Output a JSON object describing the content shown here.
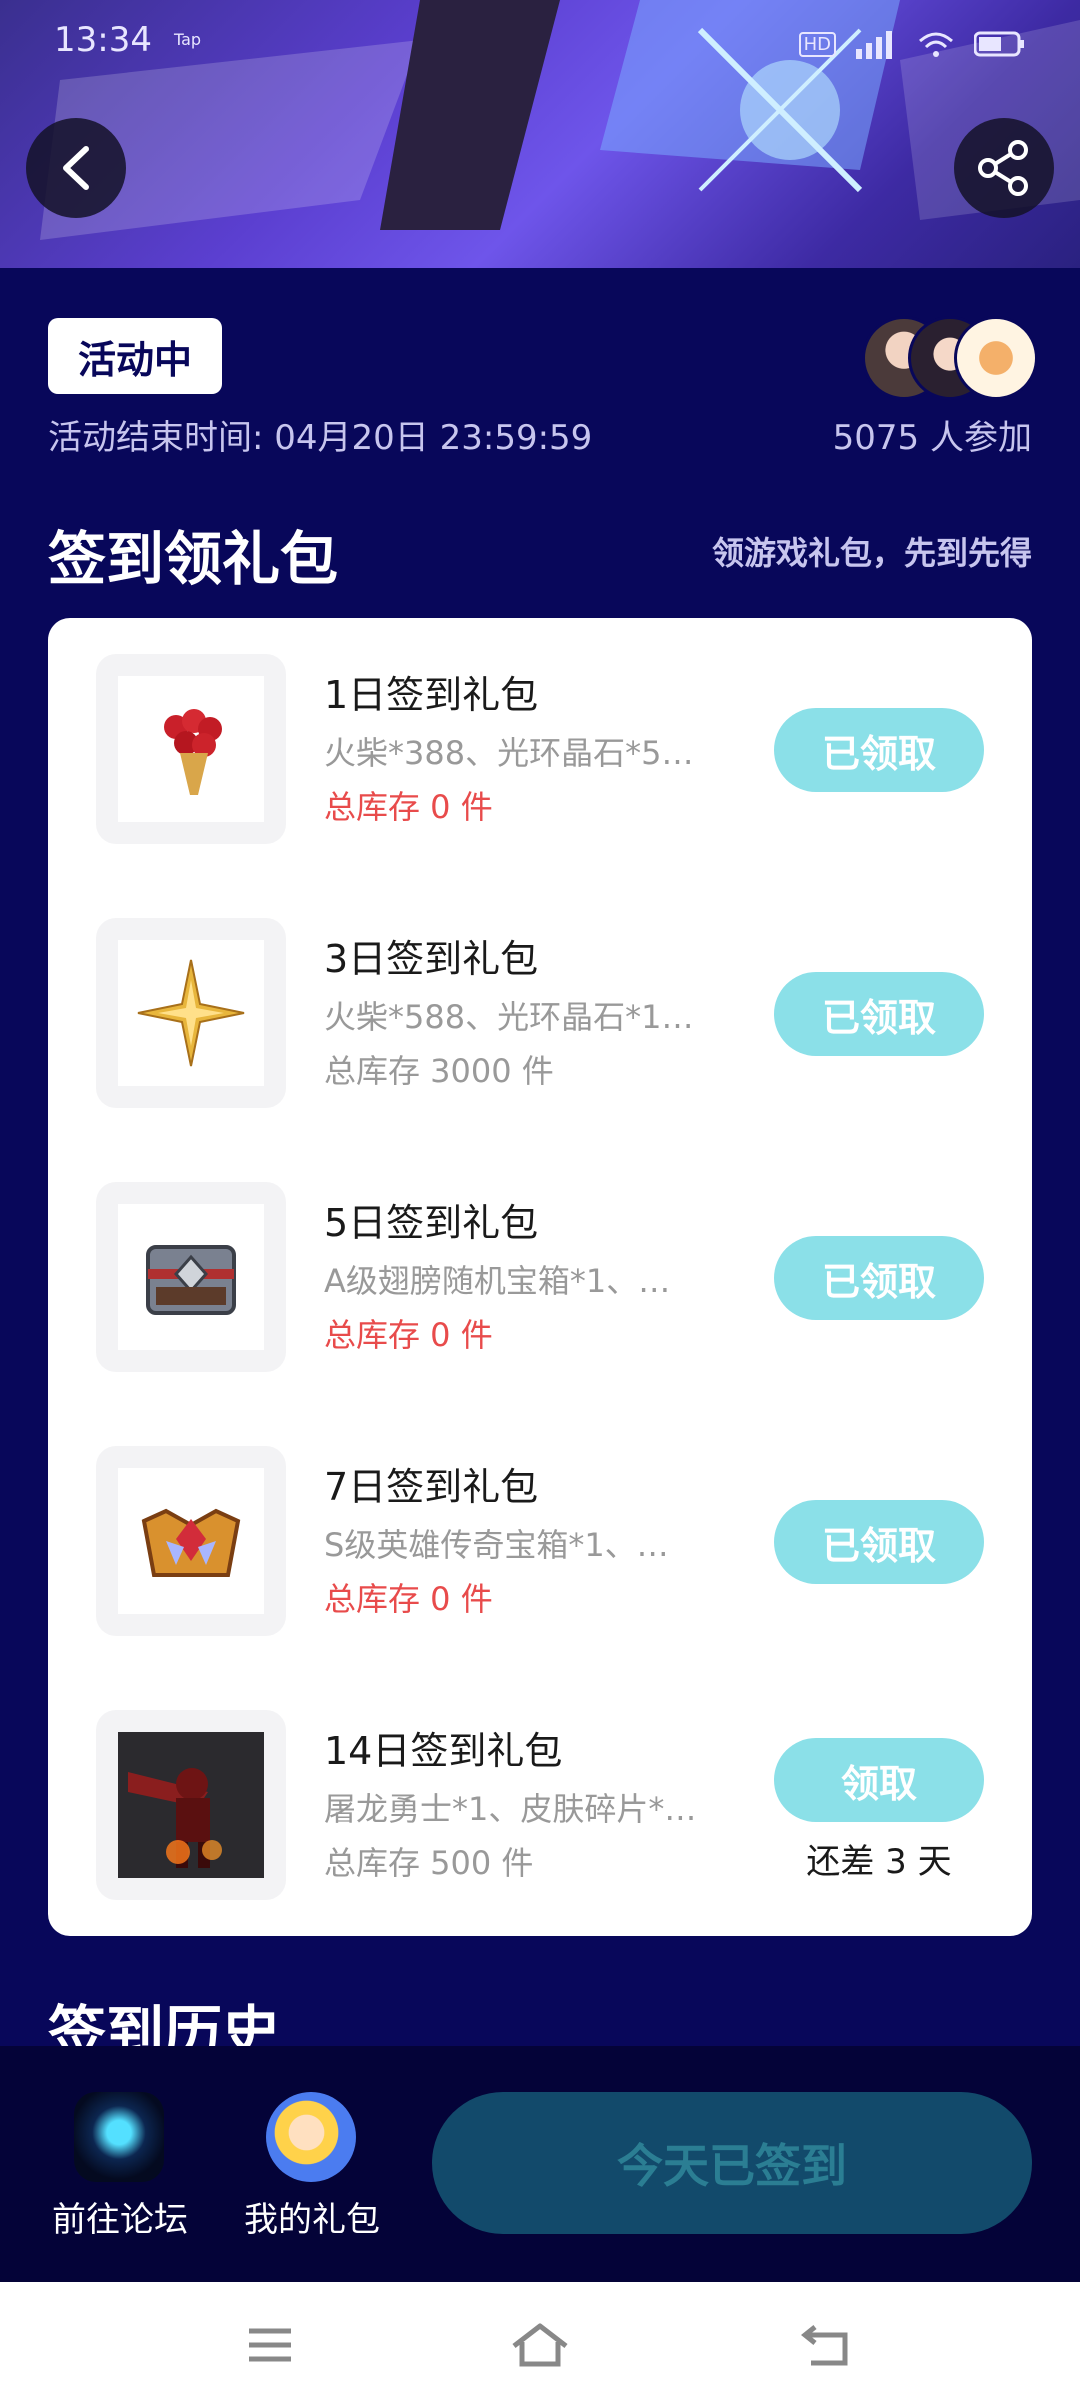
{
  "status_bar": {
    "time": "13:34",
    "app_indicator": "Tap"
  },
  "activity": {
    "status_badge": "活动中",
    "end_time": "活动结束时间: 04月20日 23:59:59",
    "participants": "5075 人参加"
  },
  "signin_section": {
    "title": "签到领礼包",
    "hint": "领游戏礼包，先到先得"
  },
  "gifts": [
    {
      "name": "1日签到礼包",
      "desc": "火柴*388、光环晶石*5…",
      "stock": "总库存 0 件",
      "button": "已领取",
      "note": ""
    },
    {
      "name": "3日签到礼包",
      "desc": "火柴*588、光环晶石*1…",
      "stock": "总库存 3000 件",
      "button": "已领取",
      "note": ""
    },
    {
      "name": "5日签到礼包",
      "desc": "A级翅膀随机宝箱*1、…",
      "stock": "总库存 0 件",
      "button": "已领取",
      "note": ""
    },
    {
      "name": "7日签到礼包",
      "desc": "S级英雄传奇宝箱*1、…",
      "stock": "总库存 0 件",
      "button": "已领取",
      "note": ""
    },
    {
      "name": "14日签到礼包",
      "desc": "屠龙勇士*1、皮肤碎片*…",
      "stock": "总库存 500 件",
      "button": "领取",
      "note": "还差 3 天"
    }
  ],
  "history_section": {
    "title": "签到历史"
  },
  "bottom_bar": {
    "forum_label": "前往论坛",
    "my_gifts_label": "我的礼包",
    "signed_button": "今天已签到"
  },
  "colors": {
    "background": "#08075a",
    "button_cyan": "#8be0e8",
    "stock_red": "#e84b4b",
    "signed_button": "#124a6b"
  }
}
